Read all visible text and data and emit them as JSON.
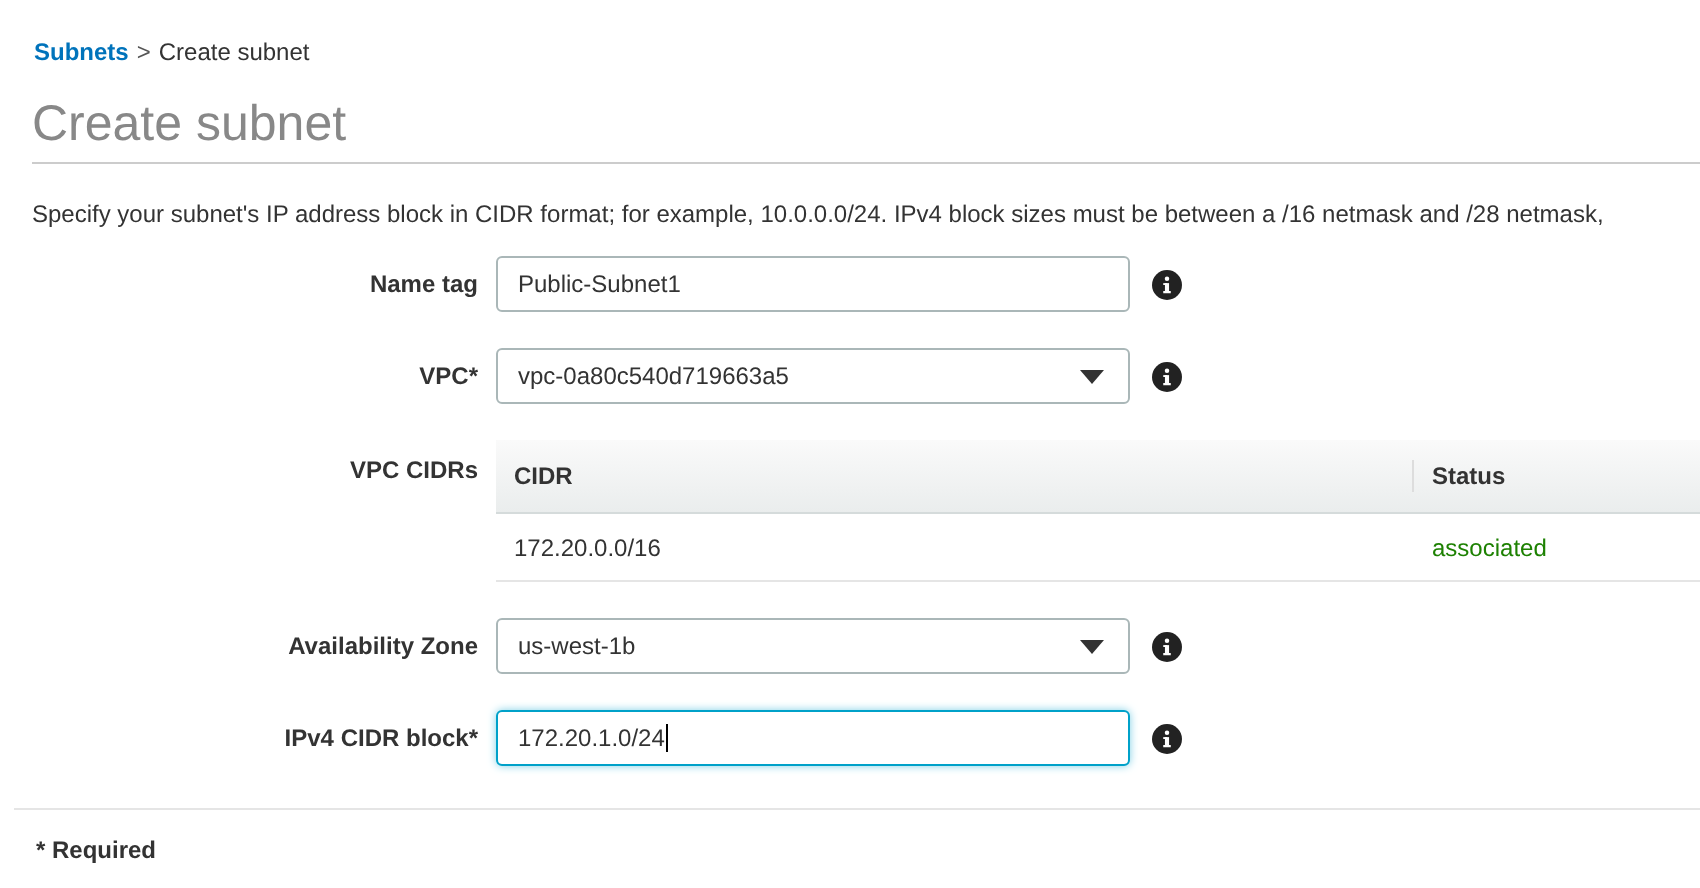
{
  "breadcrumb": {
    "link": "Subnets",
    "separator": ">",
    "current": "Create subnet"
  },
  "title": "Create subnet",
  "description": "Specify your subnet's IP address block in CIDR format; for example, 10.0.0.0/24. IPv4 block sizes must be between a /16 netmask and /28 netmask,",
  "fields": [
    {
      "kind": "text",
      "label": "Name tag",
      "value": "Public-Subnet1",
      "focused": false
    },
    {
      "kind": "select",
      "label": "VPC*",
      "value": "vpc-0a80c540d719663a5",
      "focused": false
    },
    {
      "kind": "table",
      "label": "VPC CIDRs",
      "columns": [
        "CIDR",
        "Status"
      ],
      "rows": [
        {
          "cidr": "172.20.0.0/16",
          "status": "associated",
          "color": "#1d8102"
        }
      ]
    },
    {
      "kind": "select",
      "label": "Availability Zone",
      "value": "us-west-1b",
      "focused": false
    },
    {
      "kind": "text",
      "label": "IPv4 CIDR block*",
      "value": "172.20.1.0/24",
      "focused": true
    }
  ],
  "footnote": "* Required"
}
